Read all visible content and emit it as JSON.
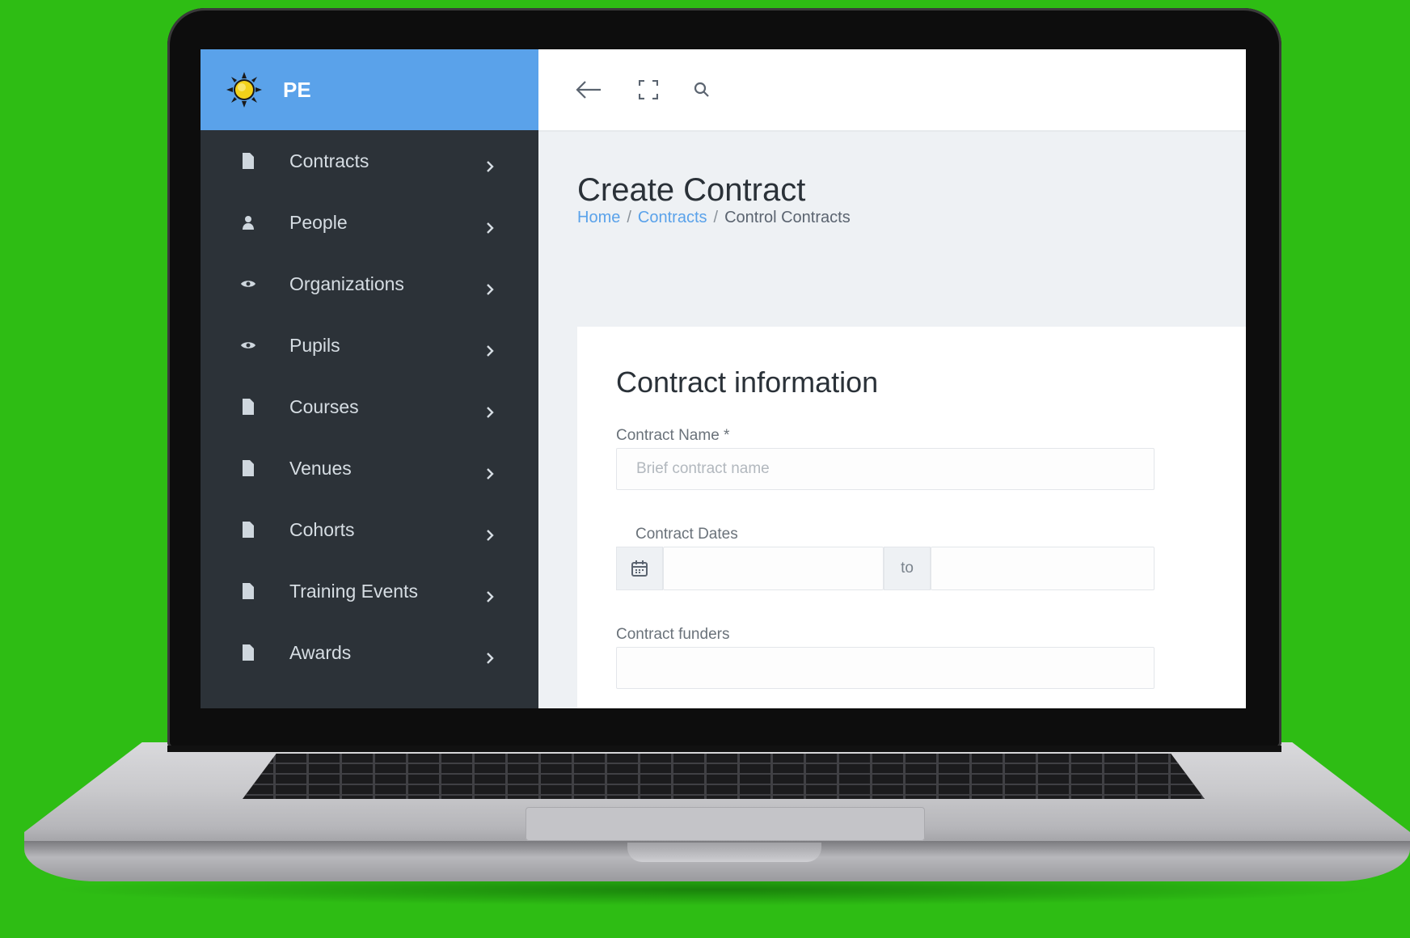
{
  "colors": {
    "background": "#2ebd14",
    "sidebar": "#2c3238",
    "brand_bar": "#5aa2ea",
    "link": "#5aa2ea"
  },
  "brand": {
    "icon": "sun-logo-icon",
    "name": "PE"
  },
  "sidebar": {
    "items": [
      {
        "label": "Contracts",
        "icon": "file-icon"
      },
      {
        "label": "People",
        "icon": "person-icon"
      },
      {
        "label": "Organizations",
        "icon": "eye-icon"
      },
      {
        "label": "Pupils",
        "icon": "eye-icon"
      },
      {
        "label": "Courses",
        "icon": "file-icon"
      },
      {
        "label": "Venues",
        "icon": "file-icon"
      },
      {
        "label": "Cohorts",
        "icon": "file-icon"
      },
      {
        "label": "Training Events",
        "icon": "file-icon"
      },
      {
        "label": "Awards",
        "icon": "file-icon"
      }
    ]
  },
  "topbar": {
    "icons": [
      "back-arrow-icon",
      "fullscreen-icon",
      "search-icon"
    ]
  },
  "page": {
    "title": "Create Contract",
    "breadcrumb": {
      "home": "Home",
      "contracts": "Contracts",
      "current": "Control Contracts",
      "separator": "/"
    }
  },
  "form": {
    "section_title": "Contract information",
    "contract_name": {
      "label": "Contract Name *",
      "placeholder": "Brief contract name",
      "value": ""
    },
    "contract_dates": {
      "label": "Contract Dates",
      "icon": "calendar-icon",
      "separator": "to",
      "start": "",
      "end": ""
    },
    "contract_funders": {
      "label": "Contract funders",
      "value": ""
    }
  }
}
